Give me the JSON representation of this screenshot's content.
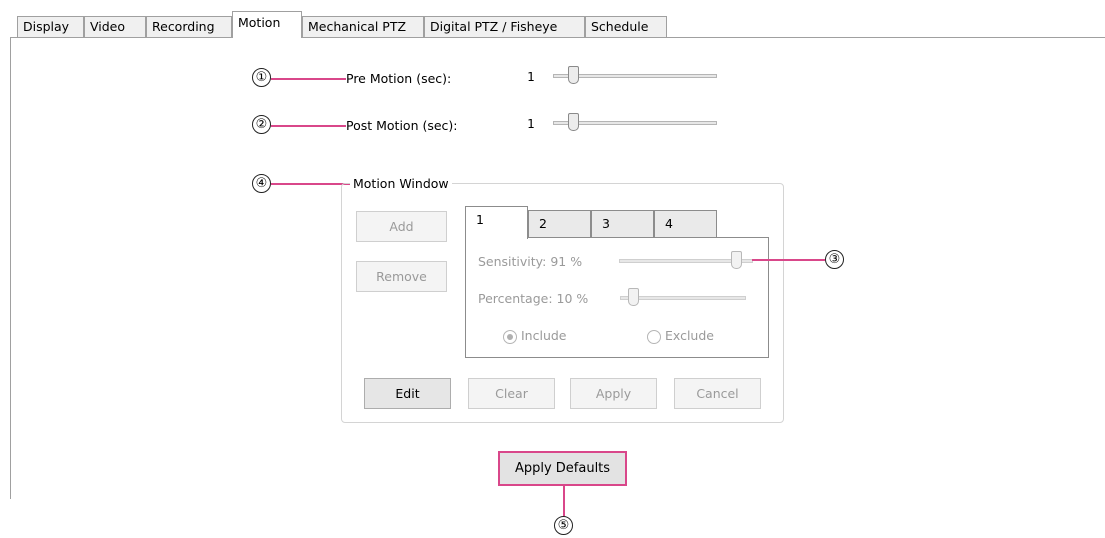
{
  "tabs": [
    "Display",
    "Video",
    "Recording",
    "Motion",
    "Mechanical PTZ",
    "Digital PTZ / Fisheye",
    "Schedule"
  ],
  "active_tab": "Motion",
  "pre_motion": {
    "label": "Pre Motion (sec):",
    "value": "1",
    "slider_fraction": 0.05
  },
  "post_motion": {
    "label": "Post Motion (sec):",
    "value": "1",
    "slider_fraction": 0.05
  },
  "motion_window": {
    "title": "Motion Window",
    "add_label": "Add",
    "remove_label": "Remove",
    "window_tabs": [
      "1",
      "2",
      "3",
      "4"
    ],
    "sensitivity_label": "Sensitivity: 91 %",
    "sensitivity_fraction": 0.91,
    "percentage_label": "Percentage: 10 %",
    "percentage_fraction": 0.1,
    "include_label": "Include",
    "exclude_label": "Exclude",
    "edit_label": "Edit",
    "clear_label": "Clear",
    "apply_label": "Apply",
    "cancel_label": "Cancel"
  },
  "apply_defaults_label": "Apply Defaults",
  "callouts": [
    "①",
    "②",
    "③",
    "④",
    "⑤"
  ],
  "colors": {
    "callout_line": "#d9478a"
  }
}
